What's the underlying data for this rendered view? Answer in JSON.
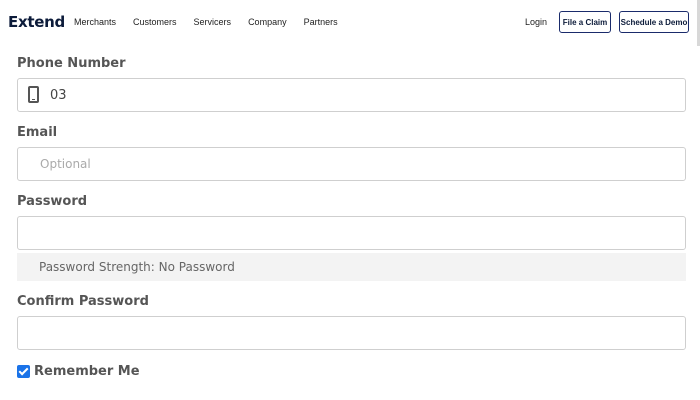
{
  "header": {
    "logo": "Extend",
    "nav": [
      "Merchants",
      "Customers",
      "Servicers",
      "Company",
      "Partners"
    ],
    "login": "Login",
    "file_claim": "File a Claim",
    "schedule_demo": "Schedule a Demo"
  },
  "form": {
    "phone": {
      "label": "Phone Number",
      "value": "03",
      "icon": "mobile-phone-icon"
    },
    "email": {
      "label": "Email",
      "placeholder": "Optional"
    },
    "password": {
      "label": "Password",
      "strength": "Password Strength: No Password"
    },
    "confirm_password": {
      "label": "Confirm Password"
    },
    "remember": {
      "label": "Remember Me",
      "checked": true
    }
  },
  "colors": {
    "brand": "#0c1b3a",
    "checkbox": "#1a73e8",
    "border": "#cfcfcf"
  }
}
